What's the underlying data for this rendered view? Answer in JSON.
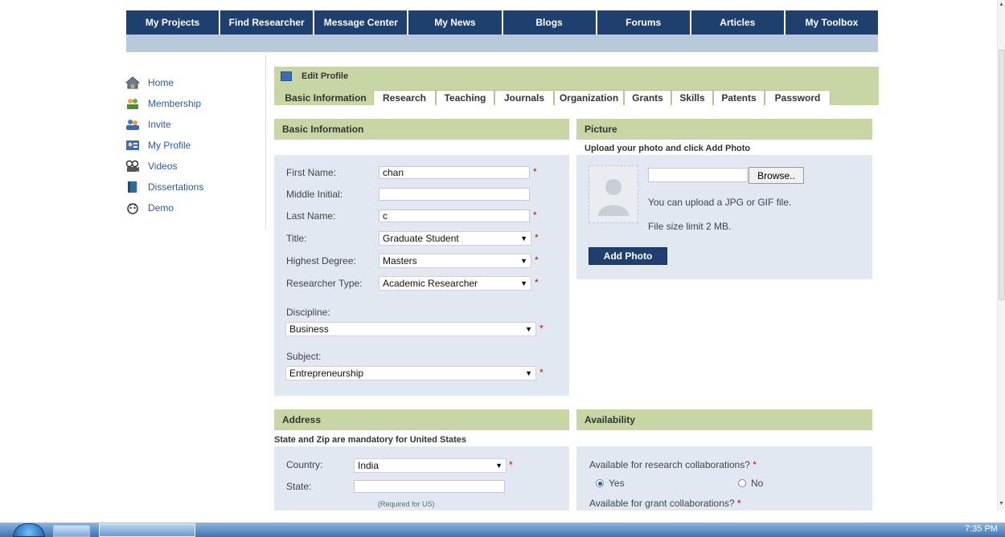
{
  "nav": {
    "items": [
      "My Projects",
      "Find Researcher",
      "Message Center",
      "My News",
      "Blogs",
      "Forums",
      "Articles",
      "My Toolbox"
    ]
  },
  "sidebar": {
    "items": [
      {
        "label": "Home",
        "icon": "home-icon"
      },
      {
        "label": "Membership",
        "icon": "membership-icon"
      },
      {
        "label": "Invite",
        "icon": "invite-icon"
      },
      {
        "label": "My Profile",
        "icon": "profile-icon"
      },
      {
        "label": "Videos",
        "icon": "videos-icon"
      },
      {
        "label": "Dissertations",
        "icon": "book-icon"
      },
      {
        "label": "Demo",
        "icon": "demo-icon"
      }
    ]
  },
  "edit_profile": {
    "title": "Edit Profile",
    "tabs": [
      "Basic Information",
      "Research",
      "Teaching",
      "Journals",
      "Organization",
      "Grants",
      "Skills",
      "Patents",
      "Password"
    ],
    "active_tab": "Basic Information"
  },
  "basic": {
    "heading": "Basic Information",
    "first_name_label": "First Name:",
    "first_name_value": "chan",
    "middle_initial_label": "Middle Initial:",
    "middle_initial_value": "",
    "last_name_label": "Last Name:",
    "last_name_value": "c",
    "title_label": "Title:",
    "title_value": "Graduate Student",
    "degree_label": "Highest Degree:",
    "degree_value": "Masters",
    "researcher_type_label": "Researcher Type:",
    "researcher_type_value": "Academic Researcher",
    "discipline_label": "Discipline:",
    "discipline_value": "Business",
    "subject_label": "Subject:",
    "subject_value": "Entrepreneurship",
    "required_mark": "*"
  },
  "picture": {
    "heading": "Picture",
    "subheading": "Upload your photo and click Add Photo",
    "browse_label": "Browse..",
    "file_value": "",
    "hint_format": "You can upload a JPG or GIF file.",
    "hint_size": "File size limit 2 MB.",
    "add_photo_label": "Add Photo"
  },
  "address": {
    "heading": "Address",
    "subheading": "State and Zip are mandatory for United States",
    "country_label": "Country:",
    "country_value": "India",
    "state_label": "State:",
    "state_value": "",
    "state_note": "(Required for US)"
  },
  "availability": {
    "heading": "Availability",
    "research_question": "Available for research collaborations?",
    "yes_label": "Yes",
    "no_label": "No",
    "research_selected": "Yes",
    "grant_question": "Available for grant collaborations?"
  },
  "taskbar": {
    "time": "7:35 PM"
  }
}
